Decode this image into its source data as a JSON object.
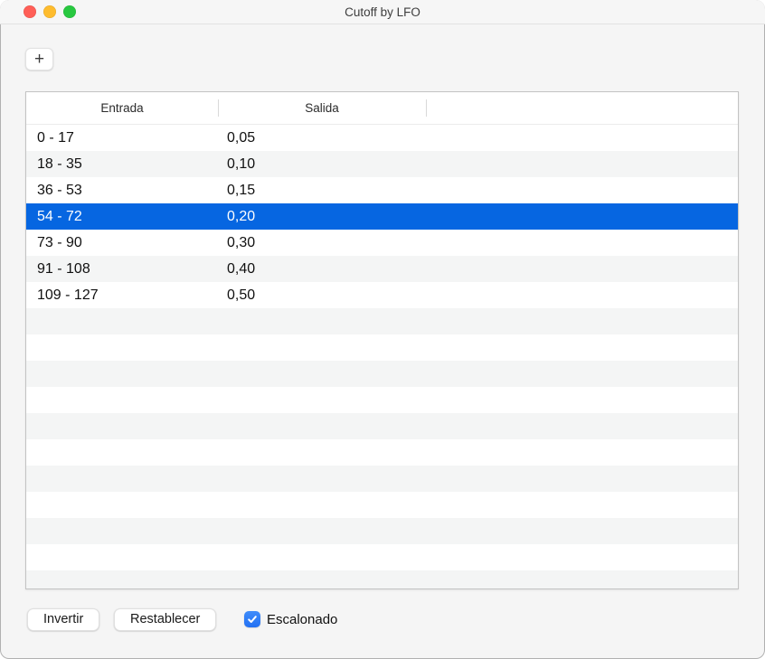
{
  "window": {
    "title": "Cutoff by LFO"
  },
  "toolbar": {
    "add_icon": "+"
  },
  "table": {
    "columns": [
      "Entrada",
      "Salida"
    ],
    "rows": [
      {
        "entrada": "0 - 17",
        "salida": "0,05"
      },
      {
        "entrada": "18 - 35",
        "salida": "0,10"
      },
      {
        "entrada": "36 - 53",
        "salida": "0,15"
      },
      {
        "entrada": "54 - 72",
        "salida": "0,20"
      },
      {
        "entrada": "73 - 90",
        "salida": "0,30"
      },
      {
        "entrada": "91 - 108",
        "salida": "0,40"
      },
      {
        "entrada": "109 - 127",
        "salida": "0,50"
      }
    ],
    "selected_index": 3
  },
  "footer": {
    "invert_label": "Invertir",
    "reset_label": "Restablecer",
    "stepped_label": "Escalonado",
    "stepped_checked": true
  },
  "colors": {
    "selection_blue": "#0666e1",
    "checkbox_blue": "#2e80f7",
    "alt_row": "#f4f5f5",
    "window_bg": "#f5f5f5",
    "traffic_red": "#ff5f57",
    "traffic_yellow": "#febc2e",
    "traffic_green": "#28c840"
  }
}
